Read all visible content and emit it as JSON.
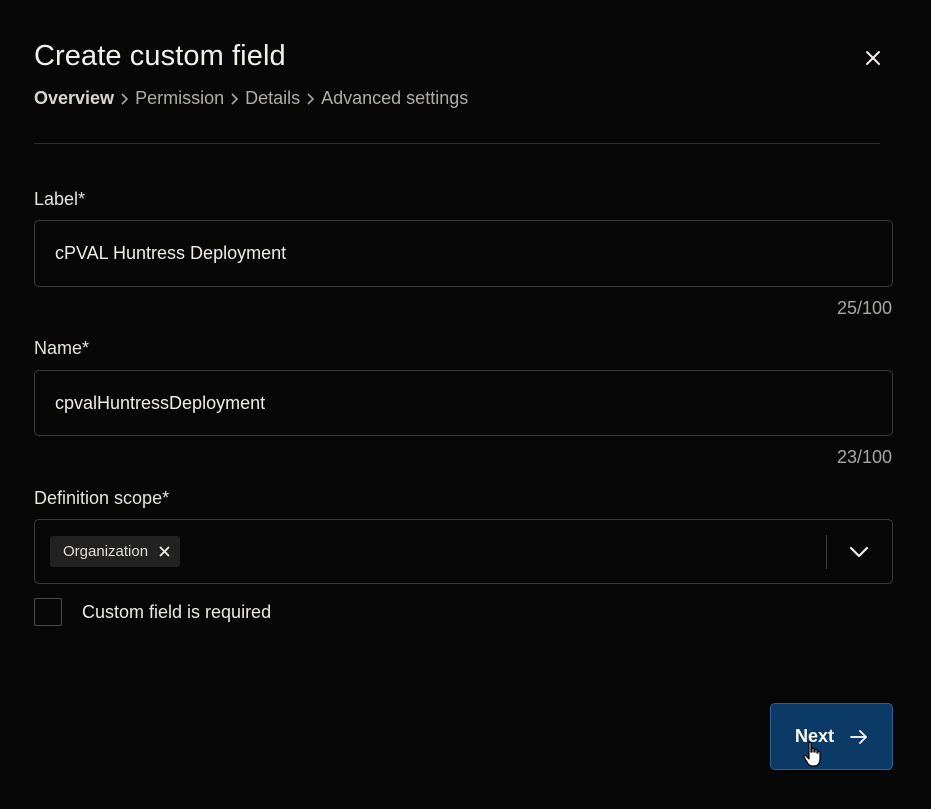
{
  "dialog": {
    "title": "Create custom field",
    "close_icon": "close-icon"
  },
  "breadcrumb": {
    "items": [
      "Overview",
      "Permission",
      "Details",
      "Advanced settings"
    ],
    "active_index": 0,
    "separator_icon": "chevron-right-icon"
  },
  "fields": {
    "label": {
      "label": "Label*",
      "value": "cPVAL Huntress Deployment",
      "counter": "25/100"
    },
    "name": {
      "label": "Name*",
      "value": "cpvalHuntressDeployment",
      "counter": "23/100"
    },
    "definition_scope": {
      "label": "Definition scope*",
      "selected": [
        "Organization"
      ],
      "remove_icon": "close-icon",
      "dropdown_icon": "chevron-down-icon"
    },
    "required": {
      "label": "Custom field is required",
      "checked": false
    }
  },
  "footer": {
    "next_label": "Next",
    "next_icon": "arrow-right-icon"
  },
  "colors": {
    "background": "#070707",
    "primary_button": "#0c3a66",
    "border": "#3a3a3a"
  }
}
